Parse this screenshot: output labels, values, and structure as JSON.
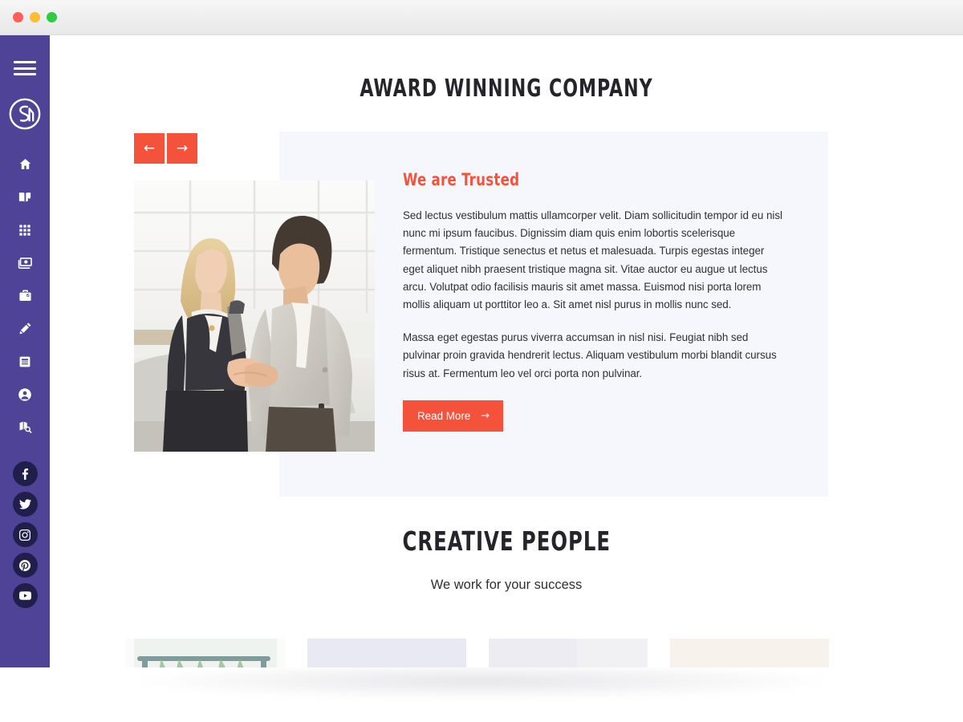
{
  "window": {
    "traffic_lights": [
      {
        "name": "close",
        "color": "#ff5f57"
      },
      {
        "name": "minimize",
        "color": "#febc2e"
      },
      {
        "name": "maximize",
        "color": "#2ecc40"
      }
    ]
  },
  "theme": {
    "sidebar_bg": "#4f4397",
    "social_bg": "#201f4c",
    "accent": "#f4523b",
    "panel_bg": "#f6f7fc",
    "heading_color": "#24242a",
    "body_color": "#2f3034",
    "page_bg": "#ffffff"
  },
  "sidebar": {
    "menu_toggle_label": "Menu",
    "logo_text": "SM",
    "nav_items": [
      {
        "icon": "home-icon",
        "label": "Home"
      },
      {
        "icon": "book-icon",
        "label": "Pages"
      },
      {
        "icon": "grid-icon",
        "label": "Portfolio"
      },
      {
        "icon": "money-icon",
        "label": "Pricing"
      },
      {
        "icon": "briefcase-icon",
        "label": "Services"
      },
      {
        "icon": "pencil-icon",
        "label": "Blog"
      },
      {
        "icon": "document-icon",
        "label": "Docs"
      },
      {
        "icon": "user-icon",
        "label": "Account"
      },
      {
        "icon": "map-search-icon",
        "label": "Contact"
      }
    ],
    "social_items": [
      {
        "icon": "facebook-icon",
        "label": "Facebook"
      },
      {
        "icon": "twitter-icon",
        "label": "Twitter"
      },
      {
        "icon": "instagram-icon",
        "label": "Instagram"
      },
      {
        "icon": "pinterest-icon",
        "label": "Pinterest"
      },
      {
        "icon": "youtube-icon",
        "label": "YouTube"
      }
    ]
  },
  "main": {
    "section_title": "AWARD WINNING COMPANY",
    "slider": {
      "prev_label": "←",
      "next_label": "→"
    },
    "feature": {
      "heading": "We are Trusted",
      "paragraph_1": "Sed lectus vestibulum mattis ullamcorper velit. Diam sollicitudin tempor id eu nisl nunc mi ipsum faucibus. Dignissim diam quis enim lobortis scelerisque fermentum. Tristique senectus et netus et malesuada. Turpis egestas integer eget aliquet nibh praesent tristique magna sit. Vitae auctor eu augue ut lectus arcu. Volutpat odio facilisis mauris sit amet massa. Euismod nisi porta lorem mollis aliquam ut porttitor leo a. Sit amet nisl purus in mollis nunc sed.",
      "paragraph_2": "Massa eget egestas purus viverra accumsan in nisl nisi. Feugiat nibh sed pulvinar proin gravida hendrerit lectus. Aliquam vestibulum morbi blandit cursus risus at. Fermentum leo vel orci porta non pulvinar.",
      "cta_label": "Read More",
      "cta_arrow": "→",
      "image_alt": "Businesswoman and businessman shaking hands in a car dealership showroom"
    },
    "team_section": {
      "title": "CREATIVE PEOPLE",
      "subtitle": "We work for your success",
      "members": [
        {
          "alt": "Team member portrait with plants background"
        },
        {
          "alt": "Team member portrait on light lavender background"
        },
        {
          "alt": "Team member portrait on light grey background"
        },
        {
          "alt": "Team member portrait with greenery background"
        }
      ]
    }
  }
}
